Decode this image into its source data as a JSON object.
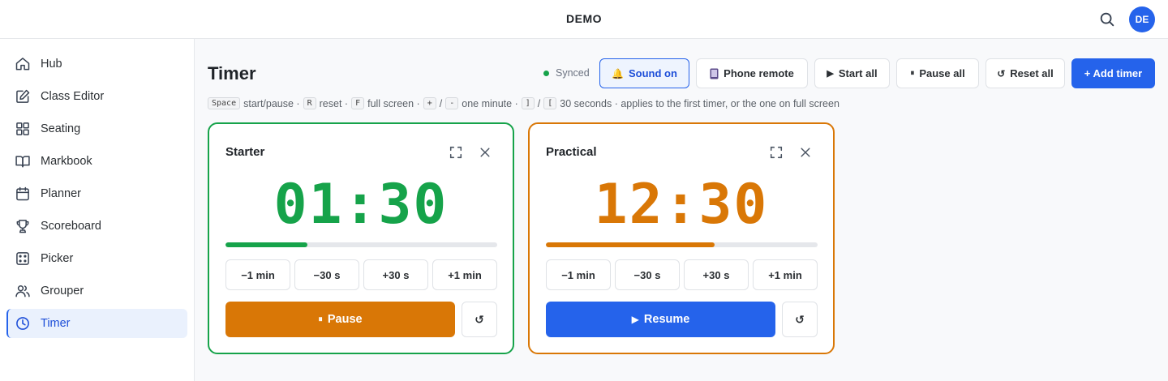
{
  "app": {
    "title": "DEMO",
    "avatar_initials": "DE"
  },
  "sidebar": {
    "items": [
      {
        "label": "Hub",
        "icon": "home-icon"
      },
      {
        "label": "Class Editor",
        "icon": "edit-icon"
      },
      {
        "label": "Seating",
        "icon": "grid-icon"
      },
      {
        "label": "Markbook",
        "icon": "book-icon"
      },
      {
        "label": "Planner",
        "icon": "calendar-icon"
      },
      {
        "label": "Scoreboard",
        "icon": "trophy-icon"
      },
      {
        "label": "Picker",
        "icon": "dice-icon"
      },
      {
        "label": "Grouper",
        "icon": "users-icon"
      },
      {
        "label": "Timer",
        "icon": "clock-icon",
        "active": true
      }
    ]
  },
  "page": {
    "title": "Timer"
  },
  "status": {
    "synced_label": "Synced"
  },
  "toolbar": {
    "sound_label": "Sound on",
    "phone_label": "Phone remote",
    "start_all_label": "Start all",
    "pause_all_label": "Pause all",
    "reset_all_label": "Reset all",
    "add_timer_label": "+ Add timer"
  },
  "hints": {
    "space_key": "Space",
    "space_text": "start/pause ·",
    "r_key": "R",
    "r_text": "reset ·",
    "f_key": "F",
    "f_text": "full screen ·",
    "plus_key": "+",
    "slash1": "/",
    "minus_key": "-",
    "minute_text": "one minute ·",
    "close_bracket_key": "]",
    "slash2": "/",
    "open_bracket_key": "[",
    "seconds_text": "30 seconds · applies to the first timer, or the one on full screen"
  },
  "timers": [
    {
      "name": "Starter",
      "time": "01:30",
      "progress": 0.3,
      "accent": "#16a34a",
      "adjust": [
        "−1 min",
        "−30 s",
        "+30 s",
        "+1 min"
      ],
      "action_label": "Pause",
      "action_color": "#d97706",
      "reset_glyph": "↺"
    },
    {
      "name": "Practical",
      "time": "12:30",
      "progress": 0.62,
      "accent": "#d97706",
      "adjust": [
        "−1 min",
        "−30 s",
        "+30 s",
        "+1 min"
      ],
      "action_label": "Resume",
      "action_color": "#2563eb",
      "reset_glyph": "↺"
    }
  ]
}
